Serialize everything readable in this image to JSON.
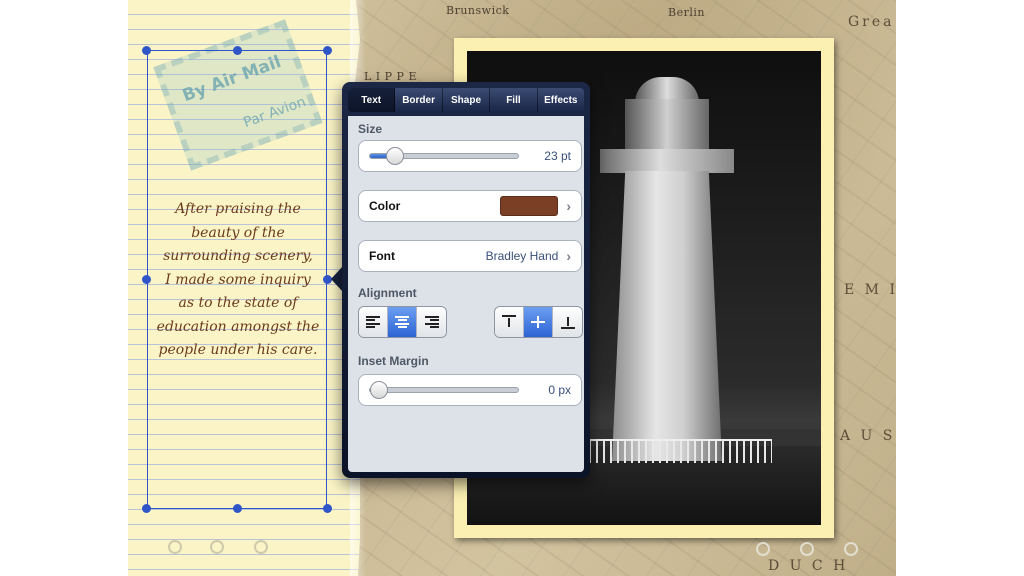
{
  "map": {
    "labels": [
      "Brunswick",
      "Berlin",
      "L I P P E",
      "Grea",
      "E M I A",
      "A U S T",
      "D U C H"
    ]
  },
  "note": {
    "lines": [
      "After praising the",
      "beauty of the",
      "surrounding scenery,",
      "I made some inquiry",
      "as to the state of",
      "education amongst the",
      "people under his care."
    ]
  },
  "stamp": {
    "line1": "By Air Mail",
    "line2": "Par Avion"
  },
  "popover": {
    "tabs": [
      "Text",
      "Border",
      "Shape",
      "Fill",
      "Effects"
    ],
    "active_tab": "Text",
    "size": {
      "label": "Size",
      "value_text": "23 pt",
      "fraction": 0.12
    },
    "color": {
      "label": "Color",
      "swatch": "#7b3f25"
    },
    "font": {
      "label": "Font",
      "value": "Bradley Hand"
    },
    "alignment": {
      "label": "Alignment",
      "horizontal_selected": "center",
      "vertical_selected": "middle"
    },
    "inset": {
      "label": "Inset Margin",
      "value_text": "0 px",
      "fraction": 0.0
    }
  },
  "colors": {
    "selection": "#2f56c9",
    "accent": "#2d64d4",
    "note_text": "#6b3a20"
  }
}
